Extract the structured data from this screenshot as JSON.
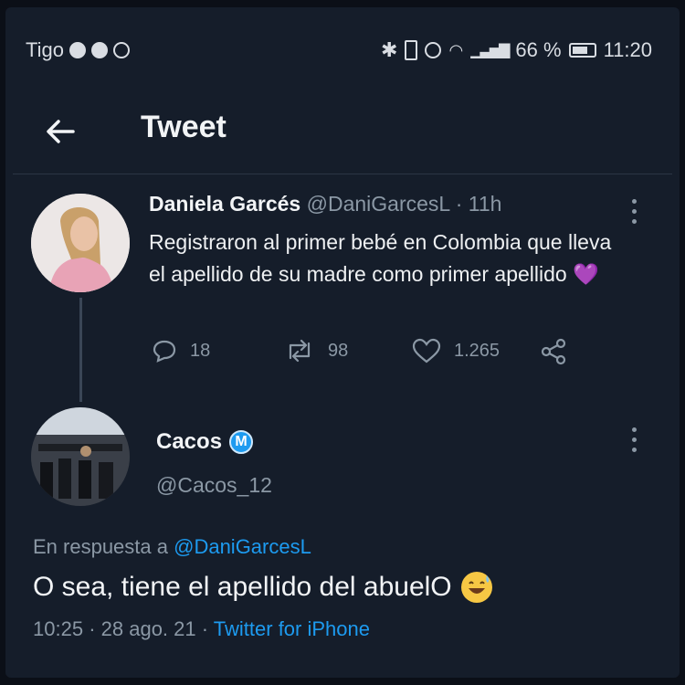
{
  "status_bar": {
    "carrier": "Tigo",
    "battery": "66 %",
    "time": "11:20"
  },
  "header": {
    "title": "Tweet"
  },
  "original_tweet": {
    "author_name": "Daniela Garcés",
    "author_handle": "@DaniGarcesL",
    "time_ago": "11h",
    "text": "Registraron al primer bebé en Colombia que lleva el apellido de su madre como primer apellido",
    "emoji": "💜",
    "replies": "18",
    "retweets": "98",
    "likes": "1.265"
  },
  "reply_tweet": {
    "author_name": "Cacos",
    "badge": "M",
    "author_handle": "@Cacos_12",
    "reply_prefix": "En respuesta a",
    "reply_to": "@DaniGarcesL",
    "text": "O sea, tiene el apellido del abuelO",
    "time": "10:25",
    "date": "28 ago. 21",
    "source": "Twitter for iPhone"
  },
  "colors": {
    "background": "#151d2a",
    "accent": "#1d9bf0",
    "muted": "#8b98a5"
  }
}
